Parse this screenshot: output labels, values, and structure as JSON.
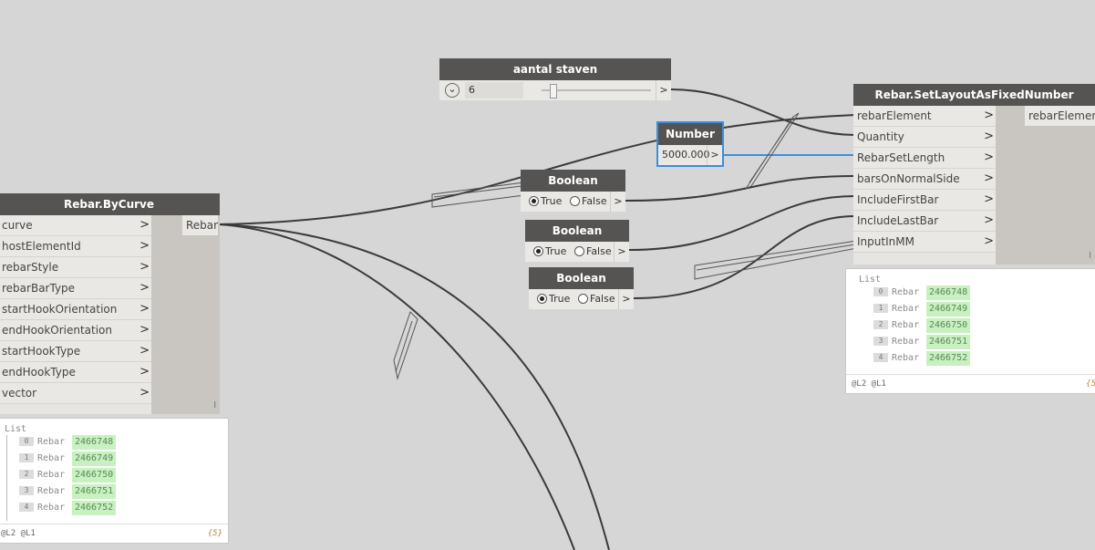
{
  "nodes": {
    "by_curve": {
      "title": "Rebar.ByCurve",
      "inputs": [
        "curve",
        "hostElementId",
        "rebarStyle",
        "rebarBarType",
        "startHookOrientation",
        "endHookOrientation",
        "startHookType",
        "endHookType",
        "vector"
      ],
      "output": "Rebar",
      "port_chevron": ">",
      "footer_mark": "l"
    },
    "slider": {
      "title": "aantal staven",
      "value": "6",
      "expand_glyph": "⌄",
      "output_glyph": ">"
    },
    "number": {
      "title": "Number",
      "value": "5000.000",
      "output_glyph": ">"
    },
    "boolean_1": {
      "title": "Boolean",
      "true_label": "True",
      "false_label": "False",
      "selected": "True",
      "output_glyph": ">"
    },
    "boolean_2": {
      "title": "Boolean",
      "true_label": "True",
      "false_label": "False",
      "selected": "True",
      "output_glyph": ">"
    },
    "boolean_3": {
      "title": "Boolean",
      "true_label": "True",
      "false_label": "False",
      "selected": "True",
      "output_glyph": ">"
    },
    "set_layout": {
      "title": "Rebar.SetLayoutAsFixedNumber",
      "inputs": [
        "rebarElement",
        "Quantity",
        "RebarSetLength",
        "barsOnNormalSide",
        "IncludeFirstBar",
        "IncludeLastBar",
        "InputInMM"
      ],
      "output": "rebarElement",
      "port_chevron": ">",
      "footer_mark": "l"
    }
  },
  "previews": {
    "by_curve": {
      "header": "List",
      "items": [
        {
          "index": "0",
          "type": "Rebar",
          "value": "2466748"
        },
        {
          "index": "1",
          "type": "Rebar",
          "value": "2466749"
        },
        {
          "index": "2",
          "type": "Rebar",
          "value": "2466750"
        },
        {
          "index": "3",
          "type": "Rebar",
          "value": "2466751"
        },
        {
          "index": "4",
          "type": "Rebar",
          "value": "2466752"
        }
      ],
      "levels": "@L2 @L1",
      "count": "{5}"
    },
    "set_layout": {
      "header": "List",
      "items": [
        {
          "index": "0",
          "type": "Rebar",
          "value": "2466748"
        },
        {
          "index": "1",
          "type": "Rebar",
          "value": "2466749"
        },
        {
          "index": "2",
          "type": "Rebar",
          "value": "2466750"
        },
        {
          "index": "3",
          "type": "Rebar",
          "value": "2466751"
        },
        {
          "index": "4",
          "type": "Rebar",
          "value": "2466752"
        }
      ],
      "levels": "@L2 @L1",
      "count": "{5"
    }
  },
  "colors": {
    "canvas": "#d6d6d6",
    "node_header": "#565452",
    "wire": "#3a3a3a",
    "selected_wire": "#3b8ee0",
    "preview_value_bg": "#c8f0c0"
  }
}
